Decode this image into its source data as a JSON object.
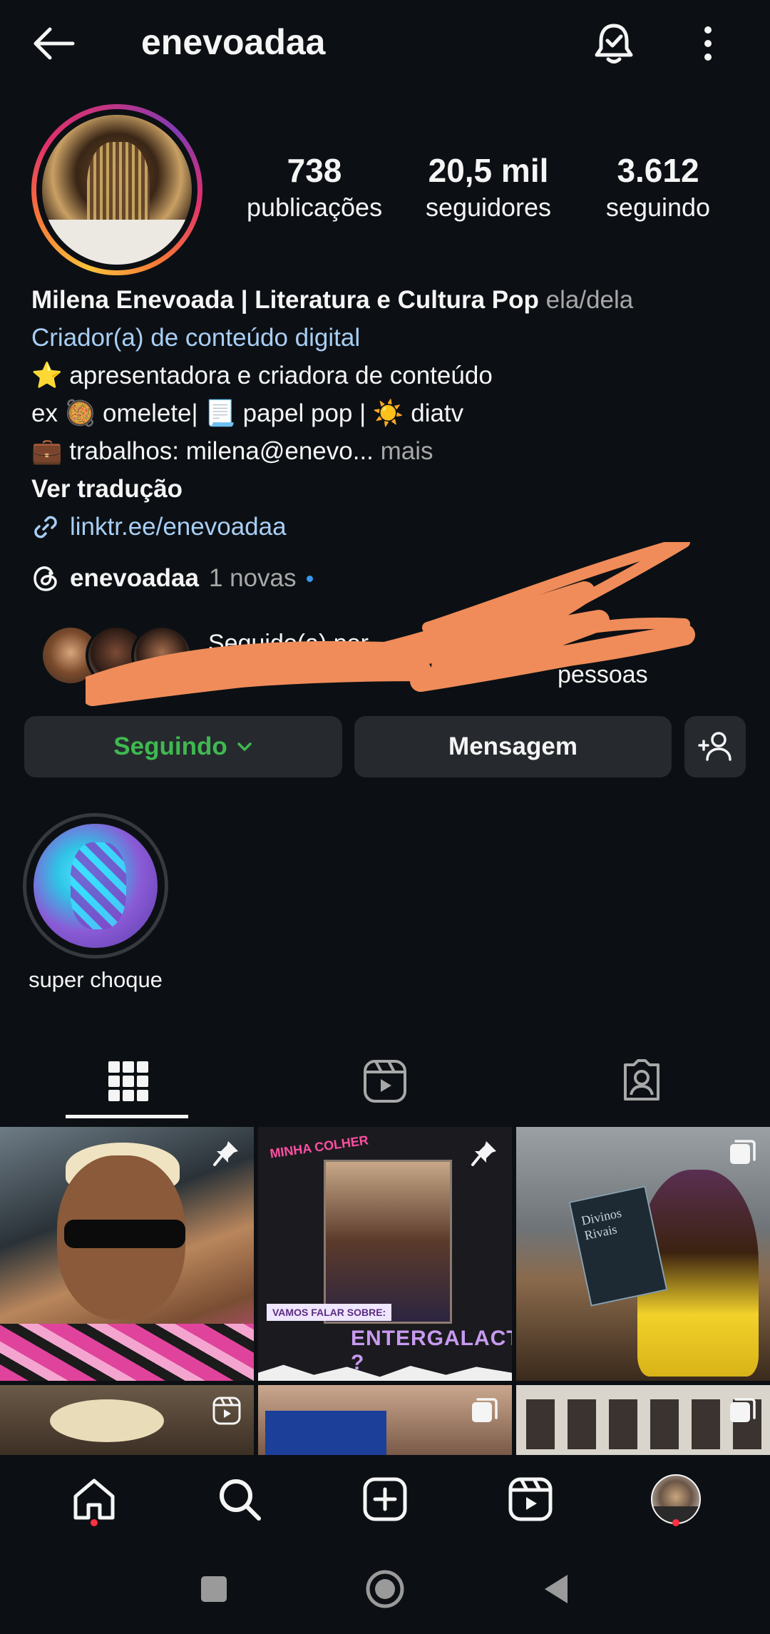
{
  "header": {
    "username": "enevoadaa"
  },
  "stats": [
    {
      "value": "738",
      "label": "publicações"
    },
    {
      "value": "20,5 mil",
      "label": "seguidores"
    },
    {
      "value": "3.612",
      "label": "seguindo"
    }
  ],
  "bio": {
    "name": "Milena Enevoada | Literatura e Cultura Pop",
    "pronouns": "ela/dela",
    "category": "Criador(a) de conteúdo digital",
    "line1": "⭐ apresentadora e criadora de conteúdo",
    "line2": "ex 🥘 omelete| 📃 papel pop | ☀️ diatv",
    "line3": "💼 trabalhos: milena@enevo...",
    "more": " mais",
    "translate": "Ver tradução",
    "link": "linktr.ee/enevoadaa"
  },
  "threads": {
    "name": "enevoadaa",
    "new_count": "1 novas"
  },
  "followed_by": {
    "text_line1": "Seguido(a) por",
    "text_line2": "pessoas"
  },
  "buttons": {
    "following": "Seguindo",
    "message": "Mensagem"
  },
  "highlights": [
    {
      "label": "super choque"
    }
  ],
  "grid": {
    "post2_brand": "MINHA COLHER",
    "post2_tag": "VAMOS FALAR SOBRE:",
    "post2_title": "ENTERGALACTIC ?",
    "post3_book": "Divinos Rivais"
  },
  "colors": {
    "background": "#0c1014",
    "button_bg": "#262a2f",
    "following_green": "#3fb950",
    "link_blue": "#a8cef5",
    "notification_red": "#ff3040",
    "scribble_orange": "#f08c5a"
  },
  "icons": {
    "back": "arrow-left-icon",
    "bell": "bell-check-icon",
    "more": "more-vertical-icon",
    "threads": "threads-icon",
    "link": "link-icon",
    "add_person": "add-person-icon",
    "grid_tab": "grid-icon",
    "reels_tab": "reels-icon",
    "tagged_tab": "tagged-icon",
    "home": "home-icon",
    "search": "search-icon",
    "create": "plus-square-icon",
    "reels": "reels-icon"
  }
}
